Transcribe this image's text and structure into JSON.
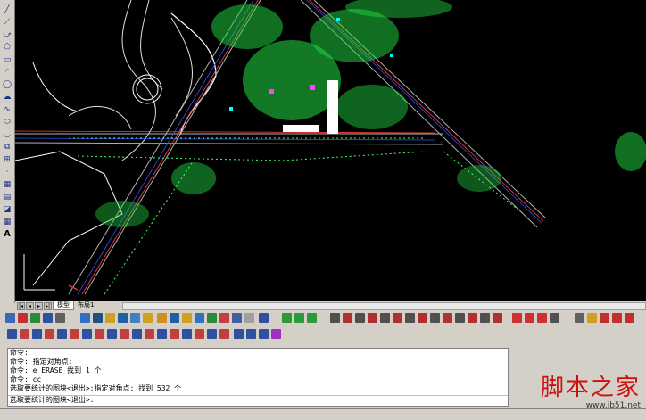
{
  "tabs": [
    {
      "label": "模型"
    },
    {
      "label": "布局1"
    }
  ],
  "command_lines": [
    "命令:",
    "命令: 指定对角点:",
    "命令: e ERASE 找到 1 个",
    "命令: cc",
    "选取要统计的图块<退出>:指定对角点: 找到 532 个"
  ],
  "command_prompt": "选取要统计的图块<退出>:",
  "watermark": {
    "title": "脚本之家",
    "url": "www.jb51.net"
  },
  "left_tools": [
    "line",
    "construction-line",
    "polyline",
    "polygon",
    "rectangle",
    "arc",
    "circle",
    "revision-cloud",
    "spline",
    "ellipse",
    "ellipse-arc",
    "insert-block",
    "make-block",
    "point",
    "hatch",
    "gradient",
    "region",
    "table",
    "multiline-text"
  ],
  "colors": {
    "canvas": "#000000",
    "ui_gray": "#d4d0c8",
    "watermark": "#cc1111"
  }
}
